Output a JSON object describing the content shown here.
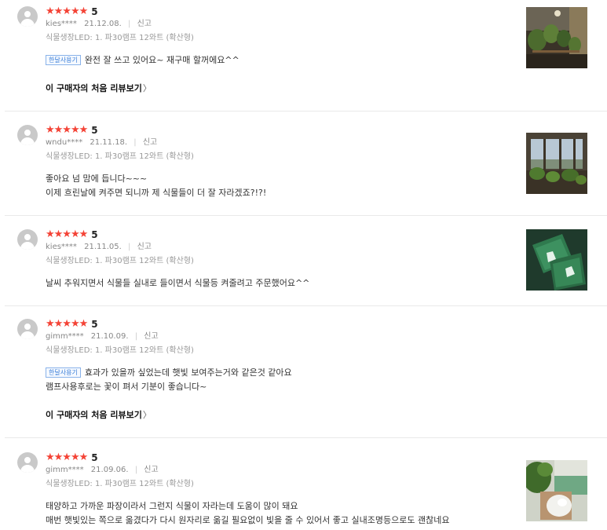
{
  "colors": {
    "star": "#f44336",
    "badge": "#3b7fd8",
    "divider": "#e9e9e9"
  },
  "reviews": [
    {
      "stars": "★★★★★",
      "score": "5",
      "user": "kies****",
      "date": "21.12.08.",
      "sep": "|",
      "report": "신고",
      "option": "식물생장LED: 1. 파30램프 12와트 (확산형)",
      "badge": "한달사용기",
      "lines": [
        "완전 잘 쓰고 있어요~ 재구매 할꺼에요^^"
      ],
      "first_review_link": "이 구매자의 처음 리뷰보기",
      "chev": "〉"
    },
    {
      "stars": "★★★★★",
      "score": "5",
      "user": "wndu****",
      "date": "21.11.18.",
      "sep": "|",
      "report": "신고",
      "option": "식물생장LED: 1. 파30램프 12와트 (확산형)",
      "lines": [
        "좋아요 넘 맘에 듭니다~~~",
        "이제 흐린날에 켜주면 되니까 제 식물들이 더 잘 자라겠죠?!?!"
      ]
    },
    {
      "stars": "★★★★★",
      "score": "5",
      "user": "kies****",
      "date": "21.11.05.",
      "sep": "|",
      "report": "신고",
      "option": "식물생장LED: 1. 파30램프 12와트 (확산형)",
      "lines": [
        "날씨 추워지면서 식물들 실내로 들이면서 식물등 켜줄려고 주문했어요^^"
      ]
    },
    {
      "stars": "★★★★★",
      "score": "5",
      "user": "gimm****",
      "date": "21.10.09.",
      "sep": "|",
      "report": "신고",
      "option": "식물생장LED: 1. 파30램프 12와트 (확산형)",
      "badge": "한달사용기",
      "lines": [
        "효과가 있을까 싶었는데 햇빛 보여주는거와 같은것 같아요",
        "램프사용후로는 꽃이 펴서 기분이 좋습니다~"
      ],
      "first_review_link": "이 구매자의 처음 리뷰보기",
      "chev": "〉"
    },
    {
      "stars": "★★★★★",
      "score": "5",
      "user": "gimm****",
      "date": "21.09.06.",
      "sep": "|",
      "report": "신고",
      "option": "식물생장LED: 1. 파30램프 12와트 (확산형)",
      "lines": [
        "태양하고 가까운 파장이라서 그런지 식물이 자라는데 도움이 많이 돼요",
        "매번 햇빛있는 쪽으로 옮겼다가 다시 원자리로 옮길 필요없이 빛을 줄 수 있어서 좋고 실내조명등으로도 괜찮네요"
      ]
    }
  ]
}
